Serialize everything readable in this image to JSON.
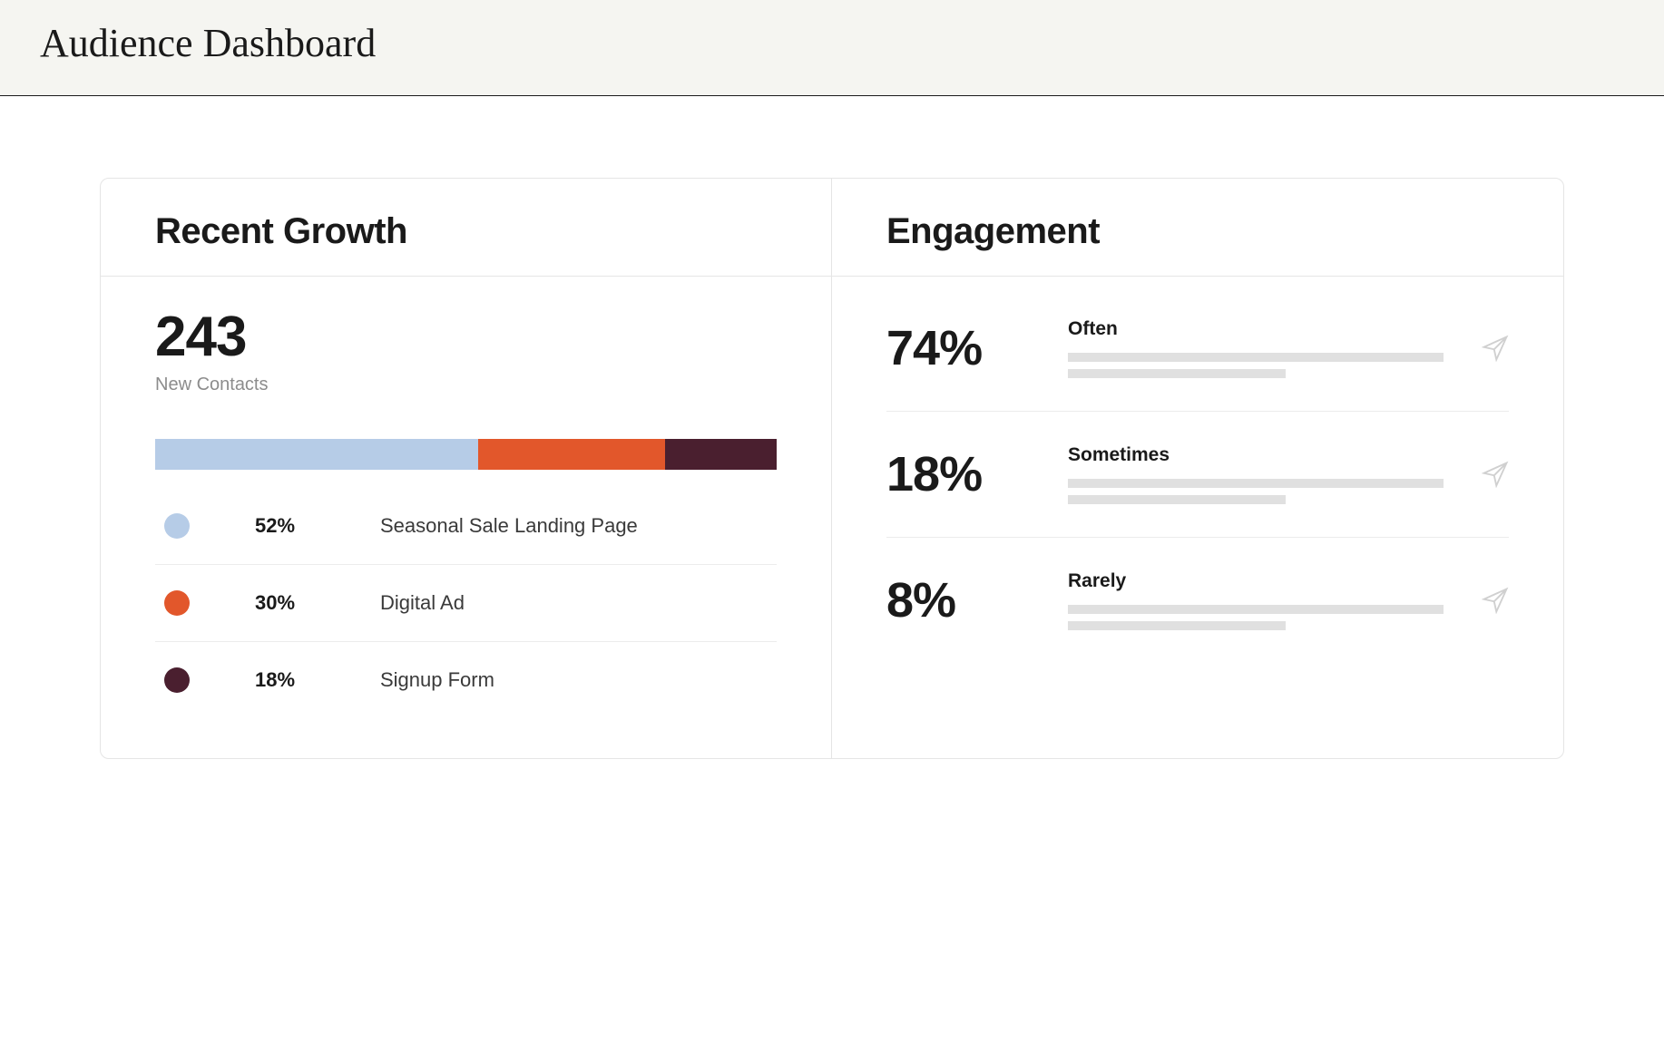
{
  "header": {
    "title": "Audience Dashboard"
  },
  "recent_growth": {
    "panel_title": "Recent Growth",
    "value": "243",
    "value_label": "New Contacts",
    "segments": [
      {
        "percent": "52%",
        "label": "Seasonal Sale Landing Page",
        "color": "#b6cce7",
        "width": 52
      },
      {
        "percent": "30%",
        "label": "Digital Ad",
        "color": "#e2572b",
        "width": 30
      },
      {
        "percent": "18%",
        "label": "Signup Form",
        "color": "#4a1f2f",
        "width": 18
      }
    ]
  },
  "engagement": {
    "panel_title": "Engagement",
    "rows": [
      {
        "percent": "74%",
        "label": "Often"
      },
      {
        "percent": "18%",
        "label": "Sometimes"
      },
      {
        "percent": "8%",
        "label": "Rarely"
      }
    ]
  },
  "chart_data": {
    "type": "bar",
    "title": "Recent Growth — source breakdown",
    "categories": [
      "Seasonal Sale Landing Page",
      "Digital Ad",
      "Signup Form"
    ],
    "values": [
      52,
      30,
      18
    ],
    "unit": "%",
    "colors": [
      "#b6cce7",
      "#e2572b",
      "#4a1f2f"
    ]
  }
}
